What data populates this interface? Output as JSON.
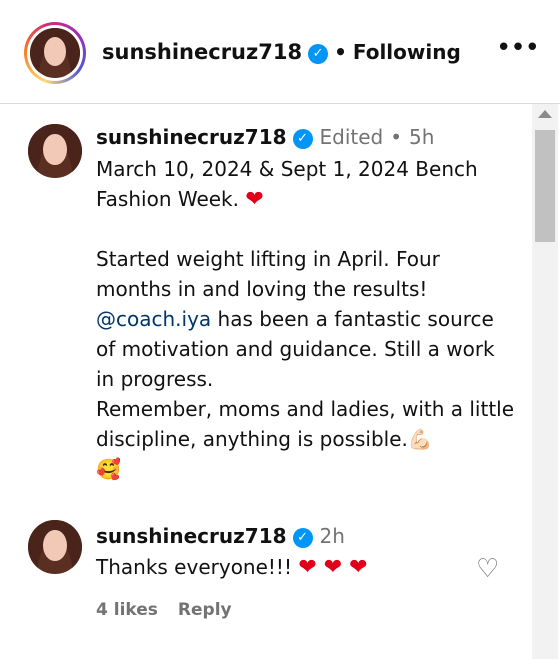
{
  "header": {
    "username": "sunshinecruz718",
    "separator": "•",
    "follow_status": "Following",
    "more_icon": "•••"
  },
  "post": {
    "username": "sunshinecruz718",
    "edited": "Edited",
    "dot": "•",
    "time": "5h",
    "caption_line1": "March 10, 2024 & Sept 1, 2024 Bench Fashion Week.",
    "caption_para2a": "Started weight lifting in April. Four months in and loving the results!",
    "mention": "@coach.iya",
    "caption_para2b": " has been a fantastic source of motivation and guidance. Still a work in progress.",
    "caption_para3": "Remember, moms and ladies, with a little discipline, anything is possible.",
    "emoji_muscle": "💪🏻",
    "emoji_love": "🥰"
  },
  "reply": {
    "username": "sunshinecruz718",
    "time": "2h",
    "text": "Thanks everyone!!!",
    "hearts": "❤ ❤ ❤",
    "likes": "4 likes",
    "reply_label": "Reply"
  }
}
